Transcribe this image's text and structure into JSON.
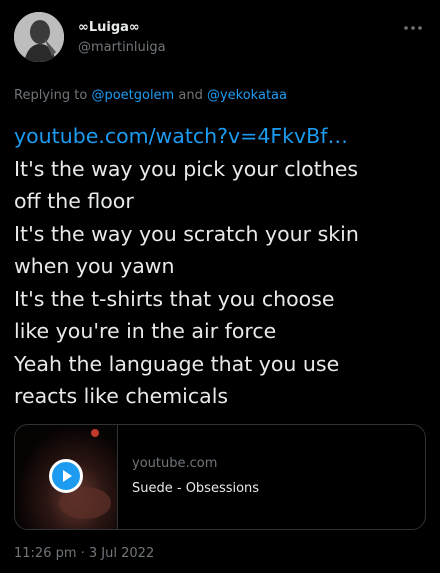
{
  "author": {
    "display_name": "∞Luiga∞",
    "handle": "@martinluiga"
  },
  "reply": {
    "prefix": "Replying to",
    "mention1": "@poetgolem",
    "conjunction": "and",
    "mention2": "@yekokataa"
  },
  "tweet": {
    "link": "youtube.com/watch?v=4FkvBf…",
    "lines": [
      "It's the way you pick your clothes",
      "off the floor",
      "It's the way you scratch your skin",
      "when you yawn",
      "It's the t-shirts that you choose",
      "like you're in the air force",
      "Yeah the language that you use",
      "reacts like chemicals"
    ]
  },
  "card": {
    "domain": "youtube.com",
    "title": "Suede - Obsessions",
    "thumbnail_icon": "play-icon"
  },
  "timestamp": "11:26 pm · 3 Jul 2022",
  "colors": {
    "background": "#000000",
    "text": "#e7e9ea",
    "secondary": "#71767b",
    "link": "#1d9bf0",
    "border": "#2f3336"
  }
}
